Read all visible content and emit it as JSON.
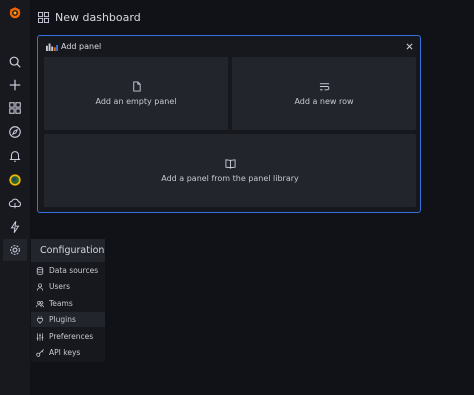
{
  "header": {
    "title": "New dashboard"
  },
  "add_panel": {
    "title": "Add panel",
    "options": [
      {
        "label": "Add an empty panel",
        "icon": "file-icon"
      },
      {
        "label": "Add a new row",
        "icon": "row-icon"
      },
      {
        "label": "Add a panel from the panel library",
        "icon": "book-icon"
      }
    ]
  },
  "sidebar": {
    "items": [
      "grafana-logo",
      "search-icon",
      "plus-icon",
      "dashboards-icon",
      "explore-icon",
      "alerting-icon",
      "user-avatar",
      "cloud-icon",
      "lightning-icon",
      "gear-icon"
    ]
  },
  "config_menu": {
    "title": "Configuration",
    "items": [
      {
        "label": "Data sources",
        "icon": "database-icon"
      },
      {
        "label": "Users",
        "icon": "user-icon"
      },
      {
        "label": "Teams",
        "icon": "users-icon"
      },
      {
        "label": "Plugins",
        "icon": "plug-icon"
      },
      {
        "label": "Preferences",
        "icon": "sliders-icon"
      },
      {
        "label": "API keys",
        "icon": "key-icon"
      }
    ],
    "active_index": 3
  },
  "colors": {
    "accent": "#3871dc",
    "background": "#111217",
    "panel": "#22252b",
    "logo": "#f46800"
  }
}
